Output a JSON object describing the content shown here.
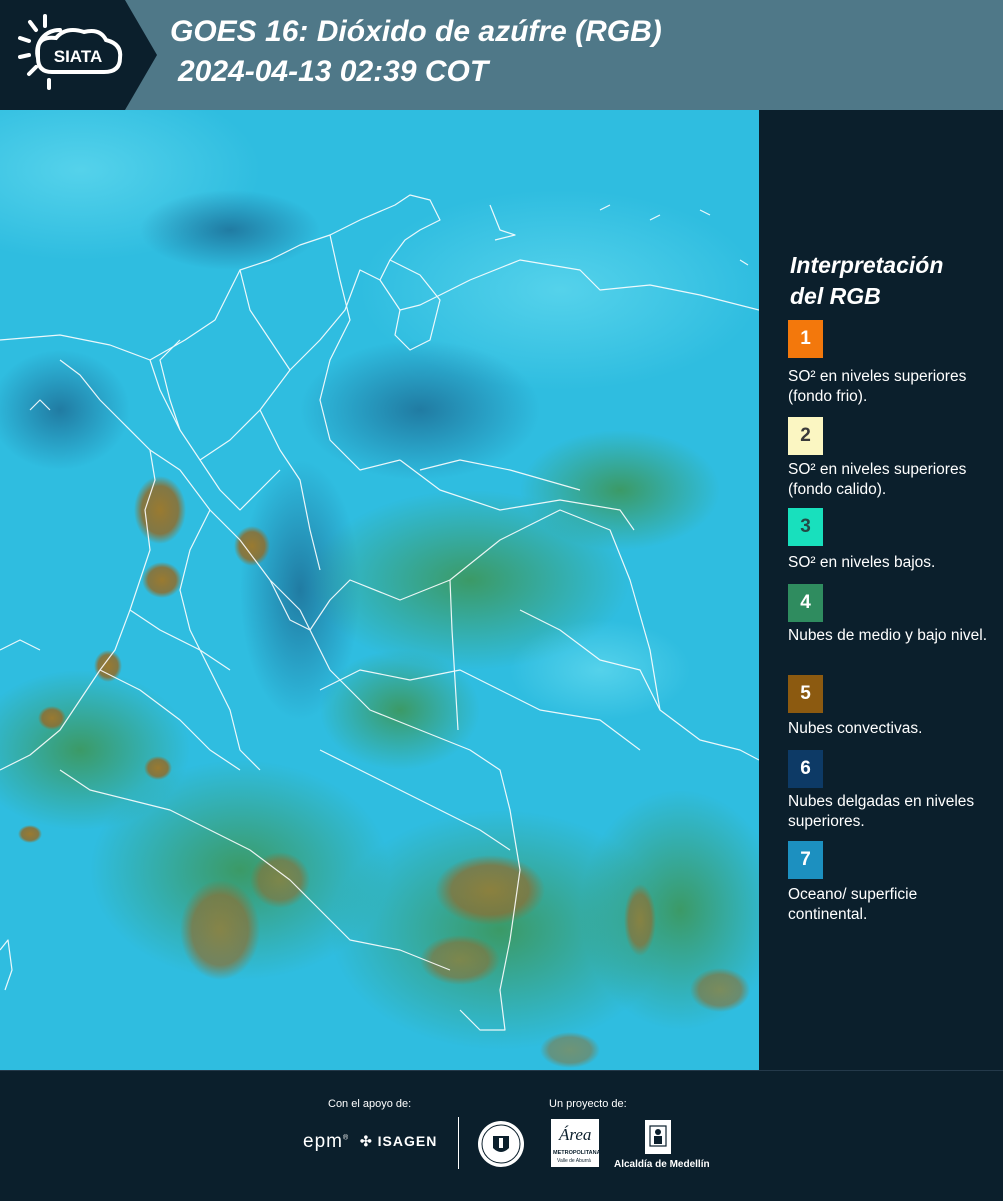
{
  "header": {
    "logo_text": "SIATA",
    "title_line1": "GOES 16: Dióxido de azúfre (RGB)",
    "title_line2": "2024-04-13 02:39 COT"
  },
  "legend": {
    "title_line1": "Interpretación",
    "title_line2": "del RGB",
    "items": [
      {
        "number": "1",
        "label": "SO² en niveles superiores (fondo frio).",
        "color": "#f3780c",
        "text_color": "#ffffff"
      },
      {
        "number": "2",
        "label": "SO² en niveles superiores (fondo calido).",
        "color": "#fbf6c2",
        "text_color": "#3a3a3a"
      },
      {
        "number": "3",
        "label": "SO² en niveles bajos.",
        "color": "#18e0bd",
        "text_color": "#234a45"
      },
      {
        "number": "4",
        "label": "Nubes de medio y bajo nivel.",
        "color": "#2f8c5f",
        "text_color": "#ffffff"
      },
      {
        "number": "5",
        "label": "Nubes convectivas.",
        "color": "#8c5a10",
        "text_color": "#ffffff"
      },
      {
        "number": "6",
        "label": "Nubes delgadas en niveles superiores.",
        "color": "#0d3a66",
        "text_color": "#ffffff"
      },
      {
        "number": "7",
        "label": "Oceano/ superficie continental.",
        "color": "#1c90c0",
        "text_color": "#ffffff"
      }
    ]
  },
  "footer": {
    "support_caption": "Con el apoyo de:",
    "project_caption": "Un proyecto de:",
    "partners": {
      "epm": "epm",
      "isagen": "ISAGEN",
      "area": "Área",
      "area_sub": "METROPOLITANA",
      "area_sub2": "Valle de Aburrá",
      "alcaldia": "Alcaldía de Medellín"
    }
  },
  "colors": {
    "header_bg": "#4f7888",
    "panel_bg": "#0b1f2c",
    "map_base": "#2fbde0",
    "cloud_green": "#3e9c6a",
    "cloud_brown": "#9a7a30"
  }
}
